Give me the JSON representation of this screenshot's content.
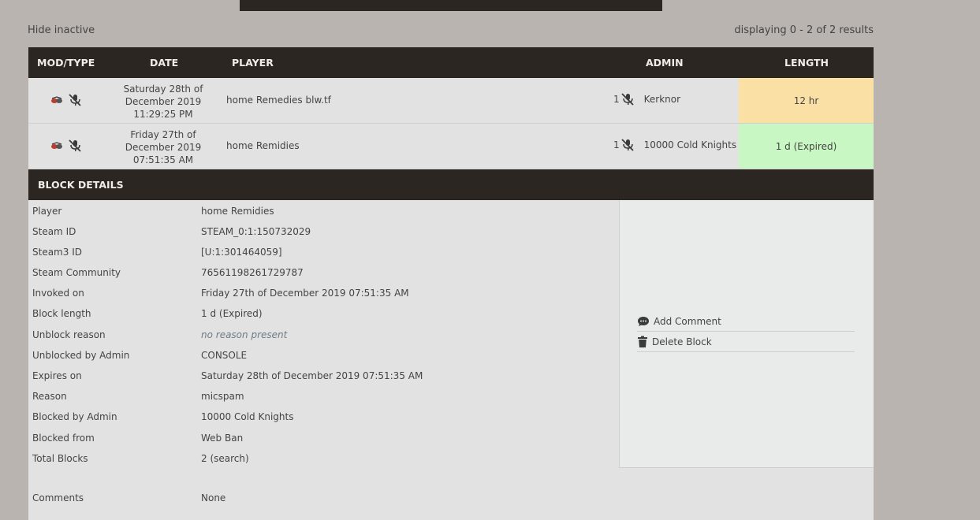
{
  "toolbar": {
    "hide_inactive": "Hide inactive",
    "results": "displaying 0 - 2 of 2 results"
  },
  "table": {
    "headers": {
      "mod_type": "MOD/TYPE",
      "date": "DATE",
      "player": "PLAYER",
      "admin": "ADMIN",
      "length": "LENGTH"
    },
    "rows": [
      {
        "mod_icons": [
          "tf2-game-icon",
          "muted-mic-icon"
        ],
        "date_line1": "Saturday 28th of",
        "date_line2": "December 2019",
        "date_line3": "11:29:25 PM",
        "player": "home Remedies blw.tf",
        "admin_count": "1",
        "admin": "Kerknor",
        "length": "12 hr",
        "length_color": "#fbe0a6"
      },
      {
        "mod_icons": [
          "tf2-game-icon",
          "muted-mic-icon"
        ],
        "date_line1": "Friday 27th of",
        "date_line2": "December 2019",
        "date_line3": "07:51:35 AM",
        "player": "home Remidies",
        "admin_count": "1",
        "admin": "10000 Cold Knights",
        "length": "1 d (Expired)",
        "length_color": "#c8f7c3"
      }
    ]
  },
  "details": {
    "title": "BLOCK DETAILS",
    "fields": [
      {
        "key": "Player",
        "value": "home Remidies"
      },
      {
        "key": "Steam ID",
        "value": "STEAM_0:1:150732029"
      },
      {
        "key": "Steam3 ID",
        "value": "[U:1:301464059]"
      },
      {
        "key": "Steam Community",
        "value": "76561198261729787"
      },
      {
        "key": "Invoked on",
        "value": "Friday 27th of December 2019 07:51:35 AM"
      },
      {
        "key": "Block length",
        "value": "1 d (Expired)"
      },
      {
        "key": "Unblock reason",
        "value": "no reason present"
      },
      {
        "key": "Unblocked by Admin",
        "value": "CONSOLE"
      },
      {
        "key": "Expires on",
        "value": "Saturday 28th of December 2019 07:51:35 AM"
      },
      {
        "key": "Reason",
        "value": "micspam"
      },
      {
        "key": "Blocked by Admin",
        "value": "10000 Cold Knights"
      },
      {
        "key": "Blocked from",
        "value": "Web Ban"
      },
      {
        "key": "Total Blocks",
        "value": "2 (search)"
      },
      {
        "key": "Comments",
        "value": "None"
      }
    ],
    "actions": {
      "add_comment": "Add Comment",
      "delete_block": "Delete Block"
    }
  },
  "colors": {
    "header_bg": "#2b2621",
    "page_bg": "#b9b4b0",
    "row_bg": "#e2e2e2"
  }
}
